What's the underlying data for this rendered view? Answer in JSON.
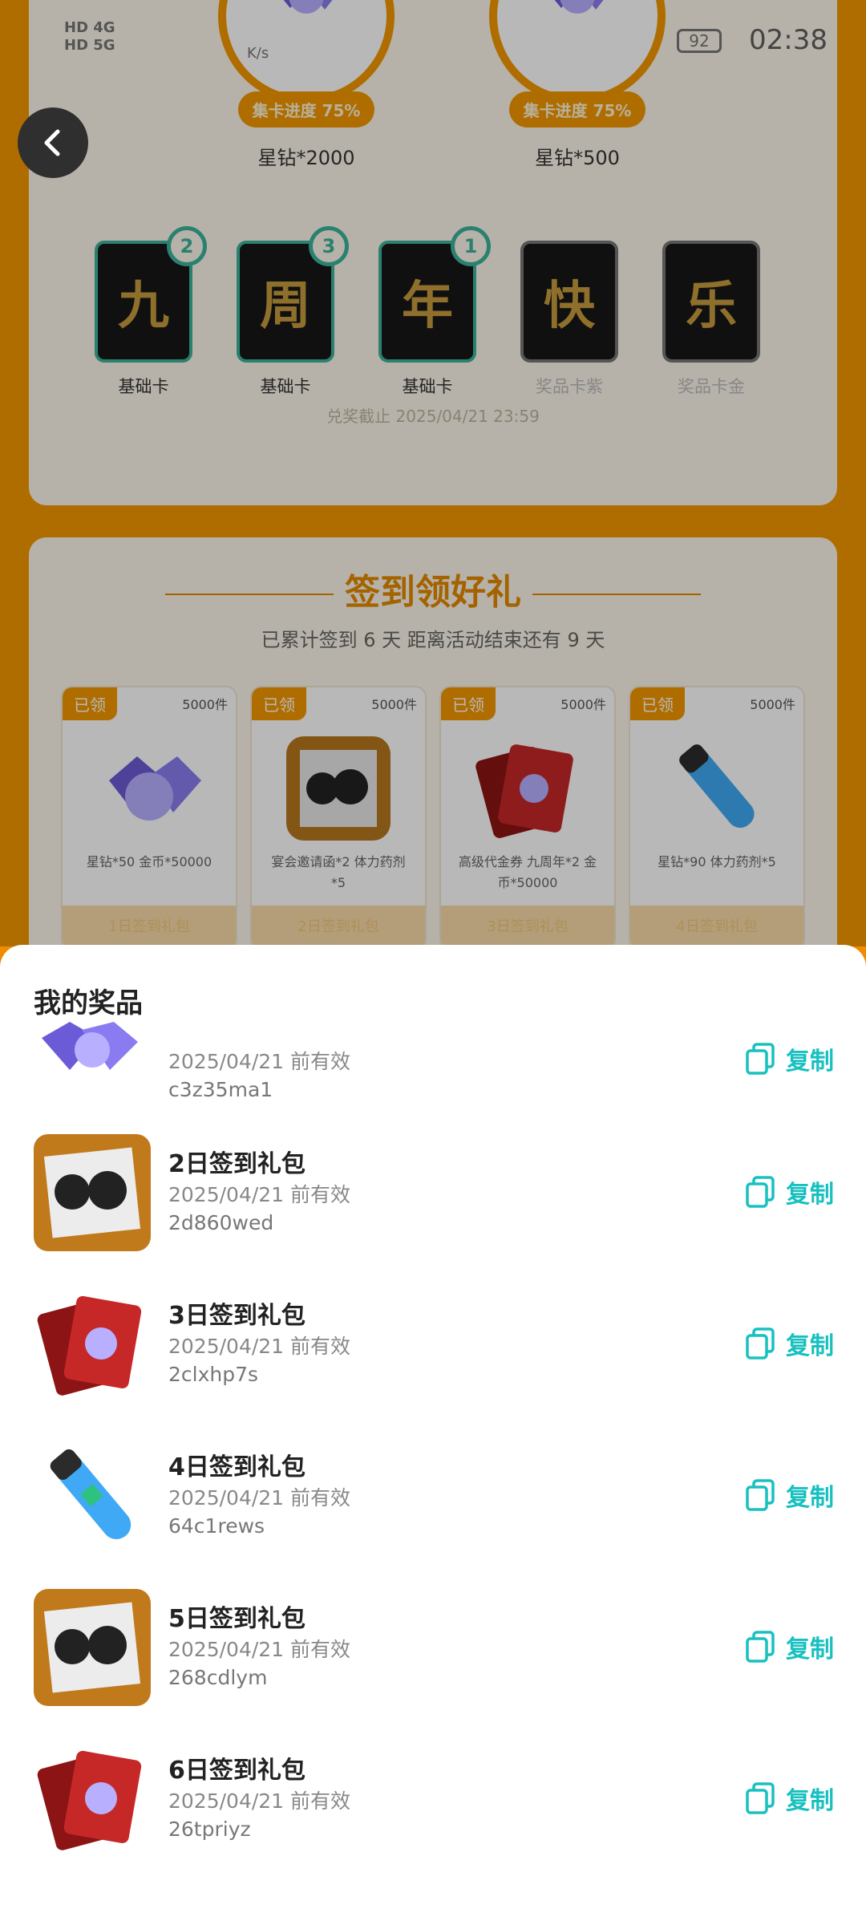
{
  "status_bar": {
    "time": "02:38",
    "battery": "92",
    "speed": "K/s",
    "net1": "HD 4G",
    "net2": "HD 5G"
  },
  "collect": {
    "prizes": [
      {
        "progress": "集卡进度 75%",
        "label": "星钻*2000"
      },
      {
        "progress": "集卡进度 75%",
        "label": "星钻*500"
      }
    ],
    "cards": [
      {
        "char": "九",
        "label": "基础卡",
        "badge": "2"
      },
      {
        "char": "周",
        "label": "基础卡",
        "badge": "3"
      },
      {
        "char": "年",
        "label": "基础卡",
        "badge": "1"
      },
      {
        "char": "快",
        "label": "奖品卡紫",
        "badge": null
      },
      {
        "char": "乐",
        "label": "奖品卡金",
        "badge": null
      }
    ],
    "deadline": "兑奖截止 2025/04/21 23:59"
  },
  "signin": {
    "title": "签到领好礼",
    "summary": "已累计签到 6 天  距离活动结束还有 9 天",
    "gifts": [
      {
        "tag": "已领",
        "count": "5000件",
        "desc": "星钻*50 金币*50000",
        "foot": "1日签到礼包"
      },
      {
        "tag": "已领",
        "count": "5000件",
        "desc": "宴会邀请函*2 体力药剂*5",
        "foot": "2日签到礼包"
      },
      {
        "tag": "已领",
        "count": "5000件",
        "desc": "高级代金券 九周年*2 金币*50000",
        "foot": "3日签到礼包"
      },
      {
        "tag": "已领",
        "count": "5000件",
        "desc": "星钻*90 体力药剂*5",
        "foot": "4日签到礼包"
      }
    ]
  },
  "sheet": {
    "title": "我的奖品",
    "copy_label": "复制",
    "items": [
      {
        "name": "",
        "date": "2025/04/21 前有效",
        "code": "c3z35ma1",
        "icon": "gem-icon"
      },
      {
        "name": "2日签到礼包",
        "date": "2025/04/21 前有效",
        "code": "2d860wed",
        "icon": "invitation-card-icon"
      },
      {
        "name": "3日签到礼包",
        "date": "2025/04/21 前有效",
        "code": "2clxhp7s",
        "icon": "voucher-card-icon"
      },
      {
        "name": "4日签到礼包",
        "date": "2025/04/21 前有效",
        "code": "64c1rews",
        "icon": "potion-icon"
      },
      {
        "name": "5日签到礼包",
        "date": "2025/04/21 前有效",
        "code": "268cdlym",
        "icon": "invitation-card-icon"
      },
      {
        "name": "6日签到礼包",
        "date": "2025/04/21 前有效",
        "code": "26tpriyz",
        "icon": "voucher-card-icon"
      }
    ]
  }
}
